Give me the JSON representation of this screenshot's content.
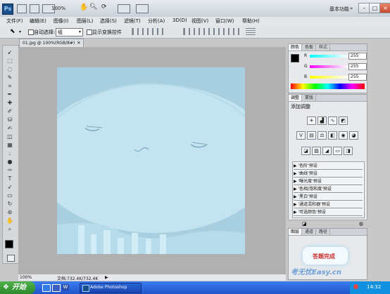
{
  "app": {
    "zoom": "100%",
    "workspace": "基本功能"
  },
  "menu": [
    "文件(F)",
    "编辑(E)",
    "图像(I)",
    "图层(L)",
    "选择(S)",
    "滤镜(T)",
    "分析(A)",
    "3D(D)",
    "视图(V)",
    "窗口(W)",
    "帮助(H)"
  ],
  "options": {
    "auto_select_label": "自动选择:",
    "auto_select_value": "组",
    "show_transform_label": "显示变换控件"
  },
  "document": {
    "tab_title": "01.jpg @ 100%(RGB/8#)"
  },
  "status": {
    "zoom": "100%",
    "doc_info": "文档:732.4K/732.4K"
  },
  "color_panel": {
    "tabs": [
      "颜色",
      "色板",
      "样式"
    ],
    "r_label": "R",
    "g_label": "G",
    "b_label": "B",
    "r": "255",
    "g": "255",
    "b": "255"
  },
  "adjust_panel": {
    "tabs": [
      "调整",
      "蒙版"
    ],
    "title": "添加调整",
    "presets": [
      "'色阶'预设",
      "'曲线'预设",
      "'曝光度'预设",
      "'色相/饱和度'预设",
      "'黑白'预设",
      "'通道混和器'预设",
      "'可选颜色'预设"
    ]
  },
  "layers_panel": {
    "tabs": [
      "图层",
      "通道",
      "路径"
    ]
  },
  "watermark": {
    "stamp": "答题完成",
    "text": "考无忧Easy.cn"
  },
  "taskbar": {
    "start_label": "开始",
    "app_label": "Adobe Photoshop",
    "clock": "14:32"
  },
  "colors": {
    "canvas_blue": "#a7cfe0",
    "jelly_light": "#c2e3ef",
    "accent": "#1b4f8a"
  }
}
